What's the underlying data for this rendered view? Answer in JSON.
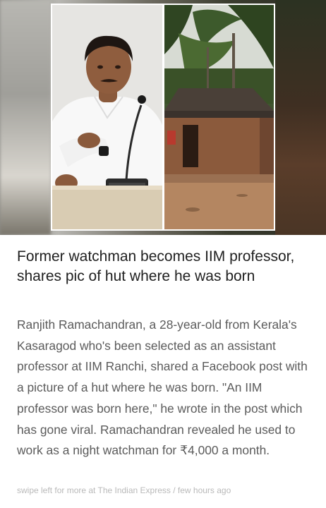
{
  "article": {
    "title": "Former watchman becomes IIM professor, shares pic of hut where he was born",
    "body": "Ranjith Ramachandran, a 28-year-old from Kerala's Kasaragod who's been selected as an assistant professor at IIM Ranchi, shared a Facebook post with a picture of a hut where he was born. \"An IIM professor was born here,\" he wrote in the post which has gone viral. Ramachandran revealed he used to work as a night watchman for ₹4,000 a month.",
    "footer": "swipe left for more at The Indian Express / few hours ago"
  },
  "images": {
    "left": "man-seated-at-desk-with-microphone",
    "right": "hut-among-palm-trees"
  }
}
